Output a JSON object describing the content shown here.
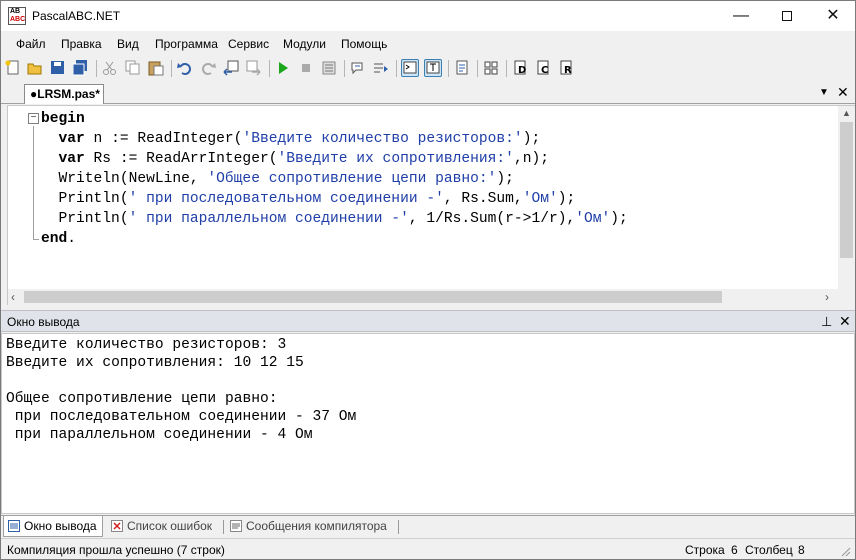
{
  "window": {
    "title": "PascalABC.NET",
    "icon_text_top": "AB",
    "icon_text_bottom": "ABC",
    "controls": [
      "minimize-icon",
      "maximize-icon",
      "close-icon"
    ]
  },
  "menu": [
    "Файл",
    "Правка",
    "Вид",
    "Программа",
    "Сервис",
    "Модули",
    "Помощь"
  ],
  "toolbar": {
    "buttons": [
      "new-file-icon",
      "open-folder-icon",
      "save-icon",
      "save-all-icon",
      "cut-icon",
      "copy-icon",
      "paste-icon",
      "undo-icon",
      "redo-icon",
      "navigate-back-icon",
      "navigate-forward-icon",
      "run-icon",
      "stop-icon",
      "compile-icon",
      "debug-step-icon",
      "debug-step-into-icon",
      "console-icon",
      "output-icon",
      "format-icon",
      "units-icon",
      "debug-icon",
      "debug2-icon",
      "debug3-icon"
    ]
  },
  "editor": {
    "tab_label": "●LRSM.pas*",
    "code": {
      "l1_kw": "begin",
      "l2_kw": "var",
      "l2_a": " n := ReadInteger(",
      "l2_s": "'Введите количество резисторов:'",
      "l2_b": ");",
      "l3_kw": "var",
      "l3_a": " Rs := ReadArrInteger(",
      "l3_s": "'Введите их сопротивления:'",
      "l3_b": ",n);",
      "l4_a": "Writeln(NewLine, ",
      "l4_s": "'Общее сопротивление цепи равно:'",
      "l4_b": ");",
      "l5_a": "Println(",
      "l5_s1": "' при последовательном соединении -'",
      "l5_b": ", Rs.Sum,",
      "l5_s2": "'Ом'",
      "l5_c": ");",
      "l6_a": "Println(",
      "l6_s1": "' при параллельном соединении -'",
      "l6_b": ", ",
      "l6_n1": "1",
      "l6_c": "/Rs.Sum(r->",
      "l6_n2": "1",
      "l6_d": "/r),",
      "l6_s2": "'Ом'",
      "l6_e": ");",
      "l7_kw": "end",
      "l7_b": "."
    }
  },
  "output_panel": {
    "title": "Окно вывода",
    "lines": [
      "Введите количество резисторов: 3",
      "Введите их сопротивления: 10 12 15",
      "",
      "Общее сопротивление цепи равно:",
      " при последовательном соединении - 37 Ом",
      " при параллельном соединении - 4 Ом"
    ]
  },
  "bottom_tabs": [
    "Окно вывода",
    "Список ошибок",
    "Сообщения компилятора"
  ],
  "status": {
    "message": "Компиляция прошла успешно (7 строк)",
    "row_label": "Строка",
    "row_value": "6",
    "col_label": "Столбец",
    "col_value": "8"
  }
}
